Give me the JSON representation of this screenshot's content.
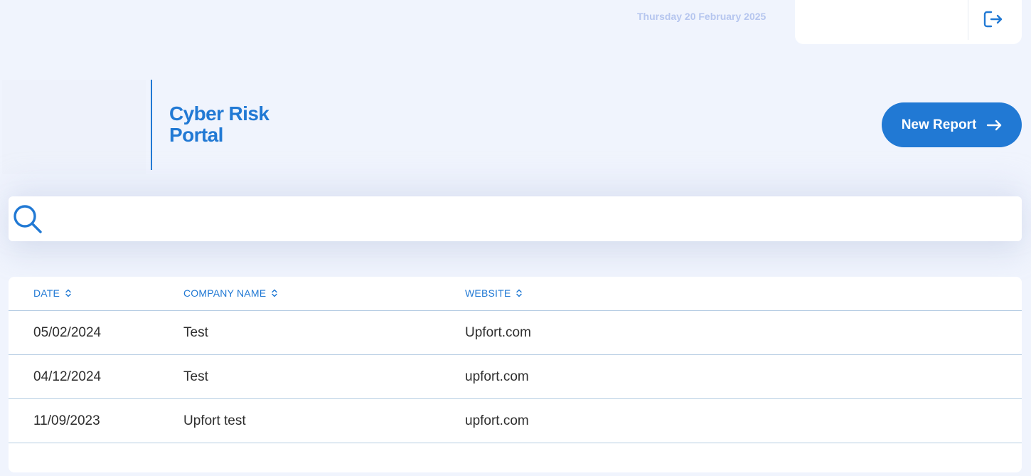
{
  "header": {
    "date": "Thursday 20 February 2025",
    "logout_icon": "logout-icon"
  },
  "brand": {
    "title_line1": "Cyber Risk",
    "title_line2": "Portal",
    "accent_color": "#2179d4"
  },
  "actions": {
    "new_report_label": "New Report",
    "new_report_icon": "arrow-right-icon"
  },
  "search": {
    "icon": "search-icon",
    "value": "",
    "placeholder": ""
  },
  "table": {
    "columns": [
      {
        "label": "DATE",
        "sort_icon": "sort-icon"
      },
      {
        "label": "COMPANY NAME",
        "sort_icon": "sort-icon"
      },
      {
        "label": "WEBSITE",
        "sort_icon": "sort-icon"
      }
    ],
    "rows": [
      {
        "date": "05/02/2024",
        "company": "Test",
        "website": "Upfort.com"
      },
      {
        "date": "04/12/2024",
        "company": "Test",
        "website": "upfort.com"
      },
      {
        "date": "11/09/2023",
        "company": "Upfort test",
        "website": "upfort.com"
      }
    ]
  }
}
